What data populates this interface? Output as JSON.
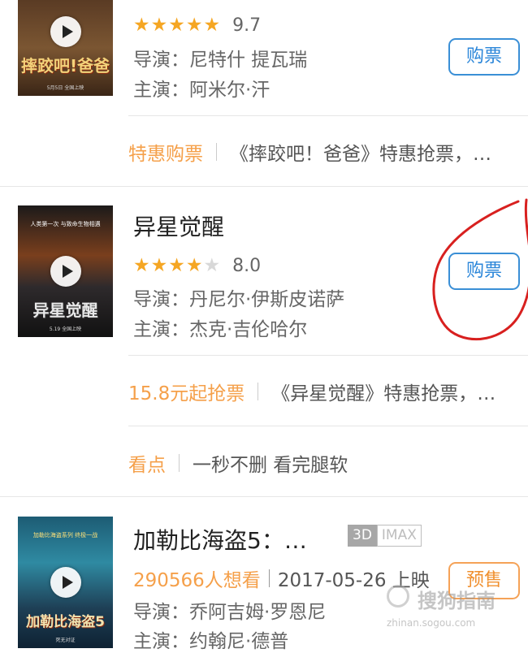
{
  "movies": [
    {
      "title": "",
      "poster_text": "摔跤吧!爸爸",
      "poster_sub": "5月5日 全国上映",
      "rating": "9.7",
      "stars_on": 5,
      "director": "导演：尼特什 提瓦瑞",
      "cast": "主演：阿米尔·汗",
      "button_label": "购票",
      "promos": [
        {
          "tag": "特惠购票",
          "desc": "《摔跤吧！爸爸》特惠抢票，…"
        }
      ]
    },
    {
      "title": "异星觉醒",
      "poster_text": "异星觉醒",
      "poster_sub": "5.19 全国上映",
      "poster_tag": "人类第一次 与致命生物相遇",
      "rating": "8.0",
      "stars_on": 4,
      "director": "导演：丹尼尔·伊斯皮诺萨",
      "cast": "主演：杰克·吉伦哈尔",
      "button_label": "购票",
      "promos": [
        {
          "tag": "15.8元起抢票",
          "desc": "《异星觉醒》特惠抢票，…"
        },
        {
          "tag": "看点",
          "desc": "一秒不删 看完腿软"
        }
      ]
    },
    {
      "title": "加勒比海盗5：…",
      "poster_text": "加勒比海盗5",
      "poster_sub": "死无对证",
      "poster_tag": "加勒比海盗系列 终极一战",
      "badge_3d": "3D",
      "badge_imax": "IMAX",
      "want_count": "290566人想看",
      "release": "2017-05-26 上映",
      "director": "导演：乔阿吉姆·罗恩尼",
      "cast": "主演：约翰尼·德普",
      "button_label": "预售"
    }
  ],
  "watermark": {
    "text": "搜狗指南",
    "url": "zhinan.sogou.com"
  },
  "colors": {
    "accent_blue": "#2b86d9",
    "accent_orange": "#f5a04a",
    "star": "#f5a623",
    "annotation_red": "#d8201f"
  },
  "icons": {
    "play": "play-icon",
    "star": "star-icon"
  }
}
